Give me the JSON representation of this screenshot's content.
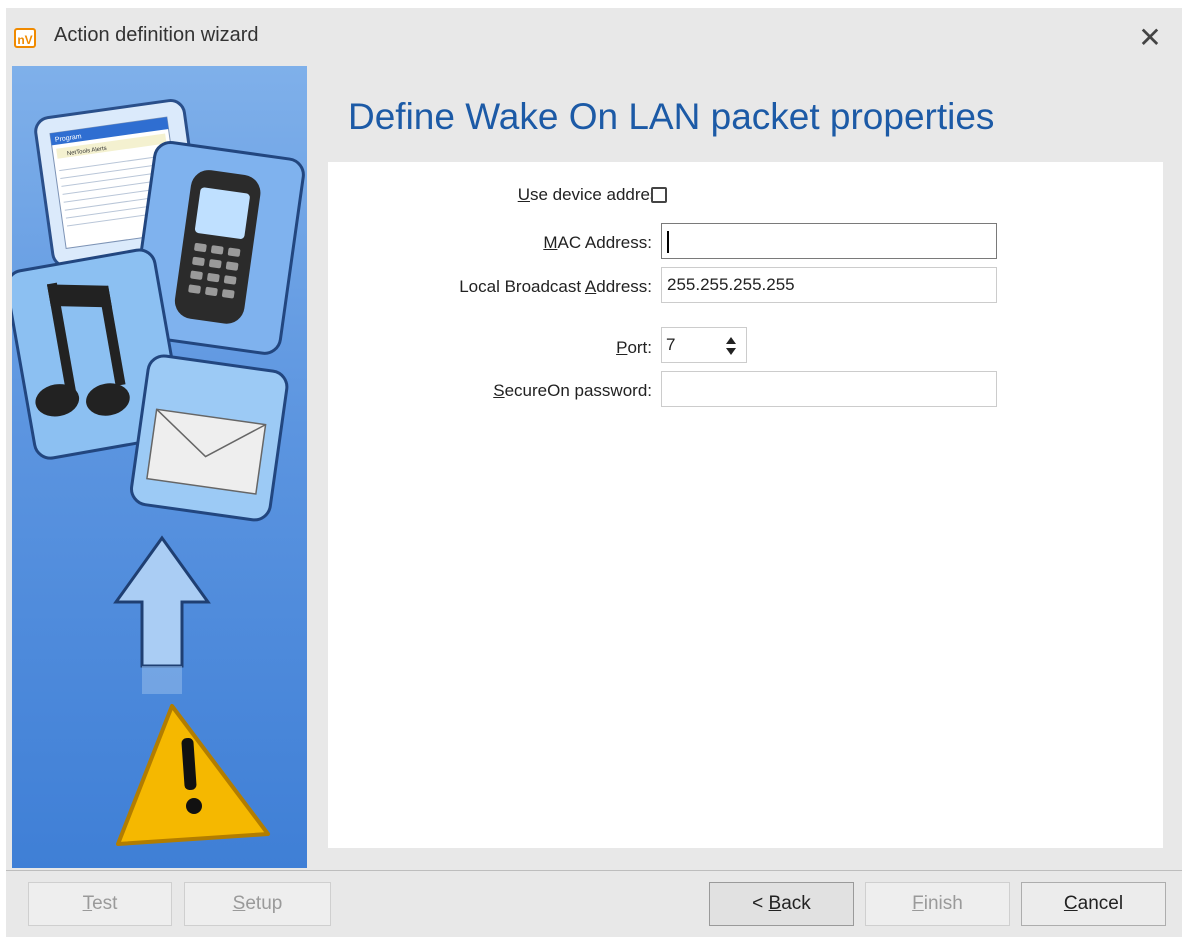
{
  "window": {
    "app_icon_text": "nV",
    "title": "Action definition wizard",
    "close_glyph": "✕"
  },
  "sidebar": {
    "illustrations": [
      "program-window-card",
      "mobile-phone-card",
      "music-note-card",
      "envelope-card",
      "up-arrow-icon",
      "warning-icon"
    ],
    "card_title": "Program",
    "card_subtitle": "NetTools Alerts"
  },
  "page": {
    "title": "Define Wake On LAN packet properties"
  },
  "form": {
    "use_device_address": {
      "label_pre": "",
      "label_accel": "U",
      "label_post": "se device address",
      "checked": false
    },
    "mac_address": {
      "label_pre": "",
      "label_accel": "M",
      "label_post": "AC Address:",
      "value": ""
    },
    "broadcast_address": {
      "label_pre": "Local Broadcast ",
      "label_accel": "A",
      "label_post": "ddress:",
      "value": "255.255.255.255"
    },
    "port": {
      "label_pre": "",
      "label_accel": "P",
      "label_post": "ort:",
      "value": "7"
    },
    "secureon_password": {
      "label_pre": "",
      "label_accel": "S",
      "label_post": "ecureOn password:",
      "value": ""
    }
  },
  "buttons": {
    "test": {
      "pre": "",
      "accel": "T",
      "post": "est",
      "enabled": false
    },
    "setup": {
      "pre": "",
      "accel": "S",
      "post": "etup",
      "enabled": false
    },
    "back": {
      "pre": "< ",
      "accel": "B",
      "post": "ack",
      "enabled": true
    },
    "finish": {
      "pre": "",
      "accel": "F",
      "post": "inish",
      "enabled": false
    },
    "cancel": {
      "pre": "",
      "accel": "C",
      "post": "ancel",
      "enabled": true
    }
  },
  "colors": {
    "title_blue": "#1c5aa6",
    "sidebar_blue": "#5c95e0",
    "window_bg": "#e8e8e8",
    "app_icon_orange": "#f08a00",
    "warning_yellow": "#f5b800"
  }
}
